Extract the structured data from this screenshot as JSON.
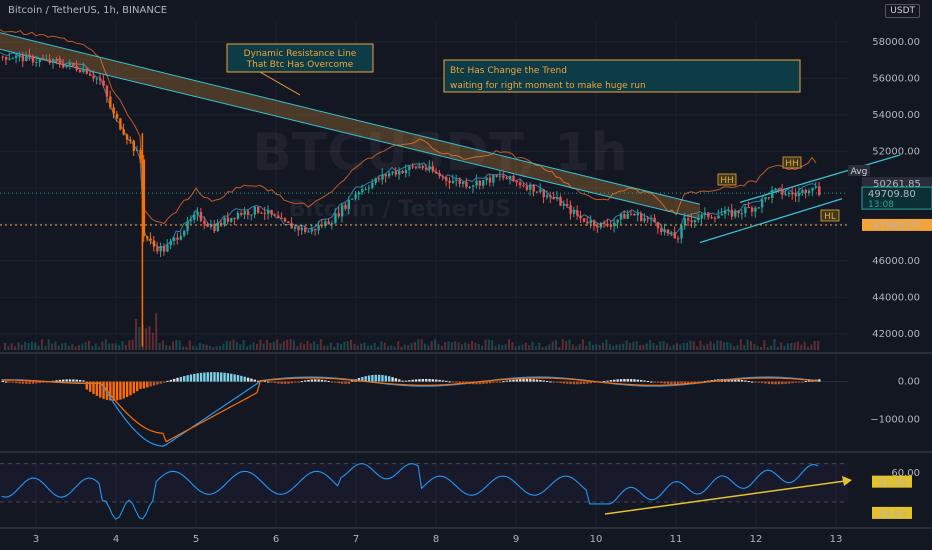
{
  "header": {
    "symbol_line": "Bitcoin / TetherUS, 1h, BINANCE",
    "currency": "USDT"
  },
  "watermark": {
    "main": "BTCUSDT, 1h",
    "sub": "Bitcoin / TetherUS"
  },
  "annotations": {
    "box1_line1": "Dynamic Resistance Line",
    "box1_line2": "That Btc Has Overcome",
    "box2_line1": "Btc Has Change the Trend",
    "box2_line2": "waiting for right moment to make huge run",
    "hh1": "HH",
    "hh2": "HH",
    "hl": "HL",
    "avg": "Avg"
  },
  "price_labels": {
    "last": "50261.85",
    "current": "49709.80",
    "countdown": "13:08",
    "ref": "47965.07"
  },
  "indicator_labels": {
    "macd_zero": "0.00",
    "macd_neg": "−1000.00",
    "rsi_60": "60.00",
    "rsi_current": "51.20",
    "rsi_low": "18.63"
  },
  "colors": {
    "up": "#26a69a",
    "down": "#ef5350",
    "orange": "#ff6d00",
    "macd_line": "#2196f3",
    "signal_line": "#ff6d00",
    "rsi": "#2196f3",
    "arrow": "#e6c229",
    "band": "#f2a33a"
  },
  "chart_data": {
    "type": "candlestick",
    "title": "Bitcoin / TetherUS, 1h, BINANCE",
    "x_ticks": [
      "3",
      "4",
      "5",
      "6",
      "7",
      "8",
      "9",
      "10",
      "11",
      "12",
      "13"
    ],
    "y_ticks": [
      42000,
      44000,
      46000,
      48000,
      50000,
      52000,
      54000,
      56000,
      58000
    ],
    "ylim": [
      41000,
      59200
    ],
    "close_path": [
      [
        2.7,
        57200
      ],
      [
        3.0,
        57000
      ],
      [
        3.3,
        56800
      ],
      [
        3.6,
        56500
      ],
      [
        3.8,
        55800
      ],
      [
        3.95,
        54000
      ],
      [
        4.1,
        53000
      ],
      [
        4.3,
        51500
      ],
      [
        4.33,
        47500
      ],
      [
        4.45,
        46800
      ],
      [
        4.6,
        46600
      ],
      [
        4.8,
        47600
      ],
      [
        5.0,
        48500
      ],
      [
        5.2,
        47800
      ],
      [
        5.5,
        48600
      ],
      [
        5.8,
        48800
      ],
      [
        6.1,
        48000
      ],
      [
        6.4,
        47600
      ],
      [
        6.7,
        48300
      ],
      [
        7.0,
        49800
      ],
      [
        7.4,
        50800
      ],
      [
        7.8,
        51200
      ],
      [
        8.1,
        50500
      ],
      [
        8.4,
        50200
      ],
      [
        8.8,
        50600
      ],
      [
        9.2,
        50000
      ],
      [
        9.5,
        49300
      ],
      [
        9.8,
        48300
      ],
      [
        10.1,
        47900
      ],
      [
        10.4,
        48600
      ],
      [
        10.7,
        48200
      ],
      [
        10.9,
        47400
      ],
      [
        11.0,
        47200
      ],
      [
        11.1,
        48200
      ],
      [
        11.4,
        48500
      ],
      [
        11.7,
        48600
      ],
      [
        12.0,
        49000
      ],
      [
        12.2,
        49800
      ],
      [
        12.5,
        49600
      ],
      [
        12.7,
        50200
      ],
      [
        12.78,
        49709.8
      ]
    ],
    "key_levels": {
      "last": 50261.85,
      "current": 49709.8,
      "ref": 47965.07
    },
    "macd": {
      "ylim": [
        -1800,
        700
      ],
      "ticks": [
        0,
        -1000
      ]
    },
    "rsi": {
      "ylim": [
        5,
        80
      ],
      "ticks": [
        60
      ],
      "current": 51.2,
      "low": 18.63
    }
  }
}
